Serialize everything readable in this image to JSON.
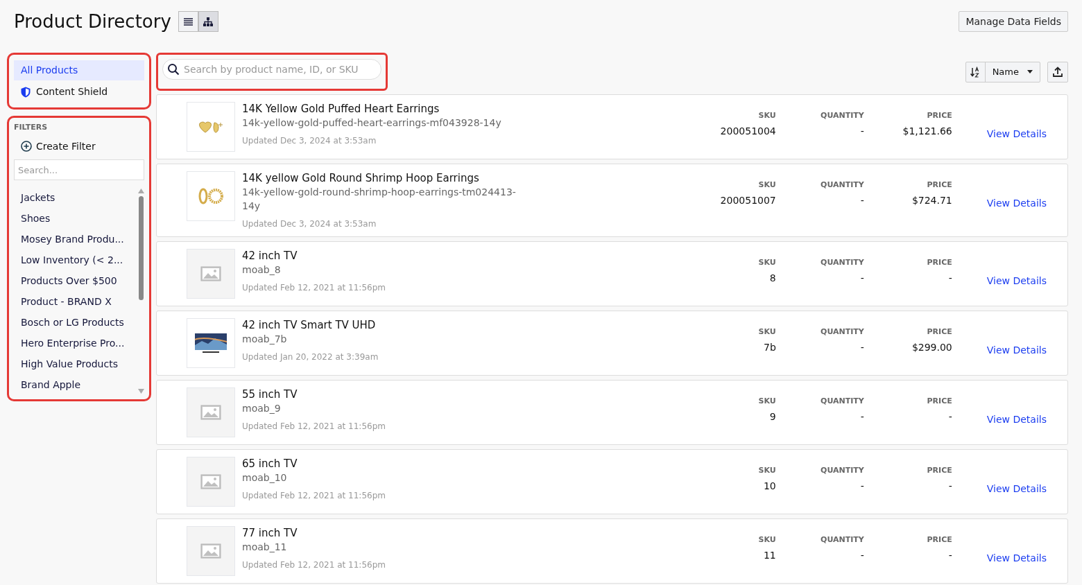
{
  "header": {
    "title": "Product Directory",
    "view_toggle": [
      {
        "kind": "list",
        "selected": false
      },
      {
        "kind": "hierarchy",
        "selected": true
      }
    ],
    "manage_button": "Manage Data Fields"
  },
  "nav": [
    {
      "kind": "plain",
      "label": "All Products",
      "selected": true
    },
    {
      "kind": "shield",
      "label": "Content Shield",
      "selected": false
    }
  ],
  "filters": {
    "heading": "FILTERS",
    "create": "Create Filter",
    "search_placeholder": "Search...",
    "items": [
      "Jackets",
      "Shoes",
      "Mosey Brand Produ...",
      "Low Inventory (< 2...",
      "Products Over $500",
      "Product - BRAND X",
      "Bosch or LG Products",
      "Hero Enterprise Pro...",
      "High Value Products",
      "Brand Apple"
    ]
  },
  "search": {
    "placeholder": "Search by product name, ID, or SKU"
  },
  "sort": {
    "field": "Name"
  },
  "products": [
    {
      "kind": "earrings",
      "name": "14K Yellow Gold Puffed Heart Earrings",
      "slug": "14k-yellow-gold-puffed-heart-earrings-mf043928-14y",
      "updated": "Updated Dec 3, 2024 at 3:53am",
      "fields": [
        {
          "label": "SKU",
          "value": "200051004"
        },
        {
          "label": "QUANTITY",
          "value": "-"
        },
        {
          "label": "PRICE",
          "value": "$1,121.66"
        }
      ],
      "link": "View Details"
    },
    {
      "kind": "earrings",
      "name": "14K yellow Gold Round Shrimp Hoop Earrings",
      "slug": "14k-yellow-gold-round-shrimp-hoop-earrings-tm024413-14y",
      "updated": "Updated Dec 3, 2024 at 3:53am",
      "fields": [
        {
          "label": "SKU",
          "value": "200051007"
        },
        {
          "label": "QUANTITY",
          "value": "-"
        },
        {
          "label": "PRICE",
          "value": "$724.71"
        }
      ],
      "link": "View Details"
    },
    {
      "kind": "placeholder",
      "name": "42 inch TV",
      "slug": "moab_8",
      "updated": "Updated Feb 12, 2021 at 11:56pm",
      "fields": [
        {
          "label": "SKU",
          "value": "8"
        },
        {
          "label": "QUANTITY",
          "value": "-"
        },
        {
          "label": "PRICE",
          "value": "-"
        }
      ],
      "link": "View Details"
    },
    {
      "kind": "tv",
      "name": "42 inch TV Smart TV UHD",
      "slug": "moab_7b",
      "updated": "Updated Jan 20, 2022 at 3:39am",
      "fields": [
        {
          "label": "SKU",
          "value": "7b"
        },
        {
          "label": "QUANTITY",
          "value": "-"
        },
        {
          "label": "PRICE",
          "value": "$299.00"
        }
      ],
      "link": "View Details"
    },
    {
      "kind": "placeholder",
      "name": "55 inch TV",
      "slug": "moab_9",
      "updated": "Updated Feb 12, 2021 at 11:56pm",
      "fields": [
        {
          "label": "SKU",
          "value": "9"
        },
        {
          "label": "QUANTITY",
          "value": "-"
        },
        {
          "label": "PRICE",
          "value": "-"
        }
      ],
      "link": "View Details"
    },
    {
      "kind": "placeholder",
      "name": "65 inch TV",
      "slug": "moab_10",
      "updated": "Updated Feb 12, 2021 at 11:56pm",
      "fields": [
        {
          "label": "SKU",
          "value": "10"
        },
        {
          "label": "QUANTITY",
          "value": "-"
        },
        {
          "label": "PRICE",
          "value": "-"
        }
      ],
      "link": "View Details"
    },
    {
      "kind": "placeholder",
      "name": "77 inch TV",
      "slug": "moab_11",
      "updated": "Updated Feb 12, 2021 at 11:56pm",
      "fields": [
        {
          "label": "SKU",
          "value": "11"
        },
        {
          "label": "QUANTITY",
          "value": "-"
        },
        {
          "label": "PRICE",
          "value": "-"
        }
      ],
      "link": "View Details"
    }
  ]
}
